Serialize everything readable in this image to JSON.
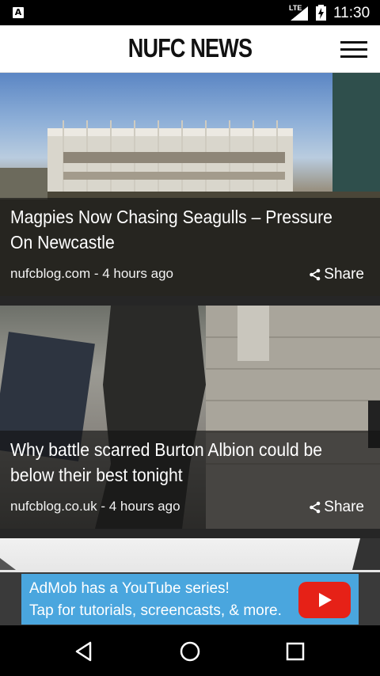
{
  "status_bar": {
    "app_icon_letter": "A",
    "network": "LTE",
    "time": "11:30"
  },
  "app_bar": {
    "title": "NUFC NEWS",
    "menu_icon": "hamburger-menu-icon"
  },
  "articles": [
    {
      "title": "Magpies Now Chasing Seagulls – Pressure On Newcastle",
      "source": "nufcblog.com",
      "time_ago": "4 hours ago",
      "meta": "nufcblog.com - 4 hours ago",
      "share_label": "Share"
    },
    {
      "title": "Why battle scarred Burton Albion could be below their best tonight",
      "source": "nufcblog.co.uk",
      "time_ago": "4 hours ago",
      "meta": "nufcblog.co.uk - 4 hours ago",
      "share_label": "Share"
    }
  ],
  "ad": {
    "line1": "AdMob has a YouTube series!",
    "line2": "Tap for tutorials, screencasts, & more.",
    "color": "#4aa6de"
  },
  "nav_bar": {
    "back_icon": "back-triangle-icon",
    "home_icon": "home-circle-icon",
    "recents_icon": "recents-square-icon"
  }
}
